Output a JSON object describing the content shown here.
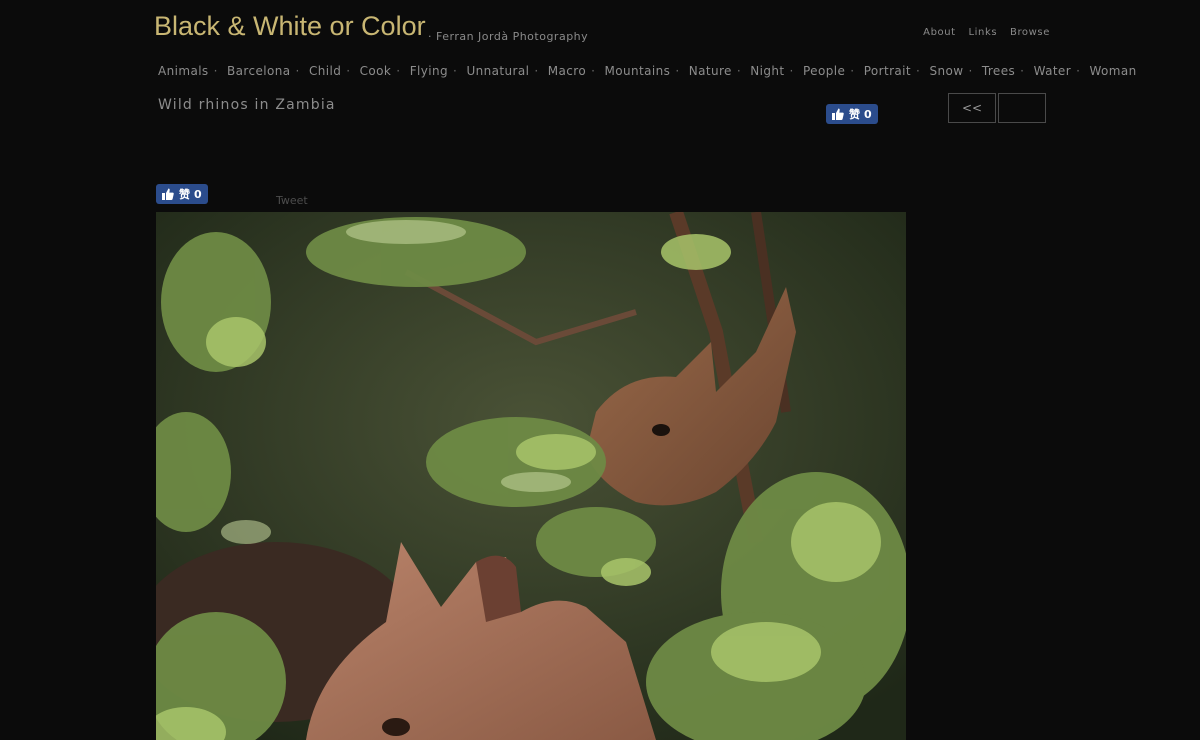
{
  "header": {
    "site_title": "Black & White or Color",
    "site_subtitle": "· Ferran Jordà Photography",
    "links": [
      "About",
      "Links",
      "Browse"
    ]
  },
  "categories": [
    "Animals",
    "Barcelona",
    "Child",
    "Cook",
    "Flying",
    "Unnatural",
    "Macro",
    "Mountains",
    "Nature",
    "Night",
    "People",
    "Portrait",
    "Snow",
    "Trees",
    "Water",
    "Woman"
  ],
  "photo": {
    "title": "Wild rhinos in Zambia"
  },
  "social": {
    "like_label": "赞",
    "like_count": "0",
    "tweet_label": "Tweet"
  },
  "pager": {
    "prev_label": "<<",
    "next_label": ""
  },
  "colors": {
    "background": "#0b0b0b",
    "title": "#c8b673",
    "fb_blue": "#2b4c8c"
  }
}
